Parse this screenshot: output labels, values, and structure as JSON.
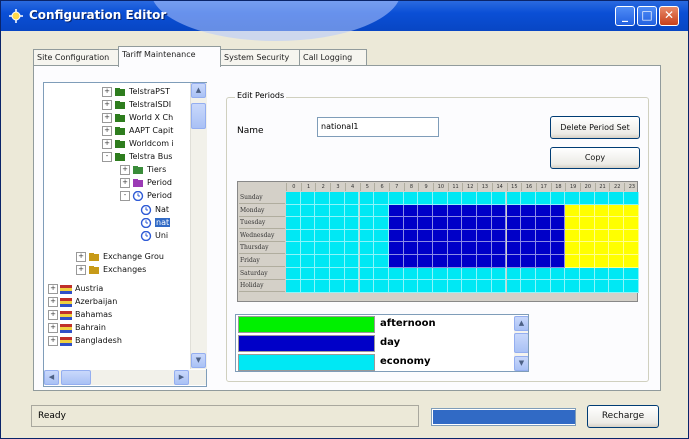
{
  "window": {
    "title": "Configuration Editor"
  },
  "tabs": [
    {
      "label": "Site Configuration",
      "active": false
    },
    {
      "label": "Tariff Maintenance",
      "active": true
    },
    {
      "label": "System Security",
      "active": false
    },
    {
      "label": "Call Logging",
      "active": false
    }
  ],
  "tree": {
    "items": [
      {
        "label": "TelstraPST",
        "expander": "+",
        "icon": "folder-tariff-icon"
      },
      {
        "label": "TelstraISDI",
        "expander": "+",
        "icon": "folder-tariff-icon"
      },
      {
        "label": "World X Ch",
        "expander": "+",
        "icon": "folder-tariff-icon"
      },
      {
        "label": "AAPT Capit",
        "expander": "+",
        "icon": "folder-tariff-icon"
      },
      {
        "label": "Worldcom i",
        "expander": "+",
        "icon": "folder-tariff-icon"
      },
      {
        "label": "Telstra Bus",
        "expander": "-",
        "icon": "folder-tariff-icon"
      },
      {
        "label": "Tiers",
        "expander": "+",
        "icon": "tiers-icon"
      },
      {
        "label": "Period",
        "expander": "+",
        "icon": "period-icon"
      },
      {
        "label": "Period",
        "expander": "-",
        "icon": "clock-icon"
      },
      {
        "label": "Nat",
        "expander": "",
        "icon": "clock-icon"
      },
      {
        "label": "nat",
        "expander": "",
        "icon": "clock-icon",
        "selected": true
      },
      {
        "label": "Uni",
        "expander": "",
        "icon": "clock-icon"
      },
      {
        "label": "Exchange Grou",
        "expander": "+",
        "icon": "exchange-group-icon"
      },
      {
        "label": "Exchanges",
        "expander": "+",
        "icon": "exchanges-icon"
      },
      {
        "label": "Austria",
        "expander": "+",
        "icon": "flag-icon"
      },
      {
        "label": "Azerbaijan",
        "expander": "+",
        "icon": "flag-icon"
      },
      {
        "label": "Bahamas",
        "expander": "+",
        "icon": "flag-icon"
      },
      {
        "label": "Bahrain",
        "expander": "+",
        "icon": "flag-icon"
      },
      {
        "label": "Bangladesh",
        "expander": "+",
        "icon": "flag-icon"
      }
    ]
  },
  "edit_periods": {
    "group_label": "Edit Periods",
    "name_label": "Name",
    "name_value": "national1",
    "delete_button": "Delete Period Set",
    "copy_button": "Copy",
    "hours": [
      "0",
      "1",
      "2",
      "3",
      "4",
      "5",
      "6",
      "7",
      "8",
      "9",
      "10",
      "11",
      "12",
      "13",
      "14",
      "15",
      "16",
      "17",
      "18",
      "19",
      "20",
      "21",
      "22",
      "23"
    ],
    "days": [
      "Sunday",
      "Monday",
      "Tuesday",
      "Wednesday",
      "Thursday",
      "Friday",
      "Saturday",
      "Holiday"
    ],
    "colors": {
      "economy": "#00e8f4",
      "day": "#0000c8",
      "evening": "#ffff00",
      "afternoon": "#00f000"
    },
    "schedule": [
      "economy",
      "day",
      "day",
      "day",
      "day",
      "day",
      "economy",
      "economy"
    ]
  },
  "periods_legend": [
    {
      "name": "afternoon",
      "color": "#00f000"
    },
    {
      "name": "day",
      "color": "#0000c8"
    },
    {
      "name": "economy",
      "color": "#00e8f4"
    }
  ],
  "status": {
    "text": "Ready",
    "progress": 1.0,
    "recharge_button": "Recharge"
  }
}
